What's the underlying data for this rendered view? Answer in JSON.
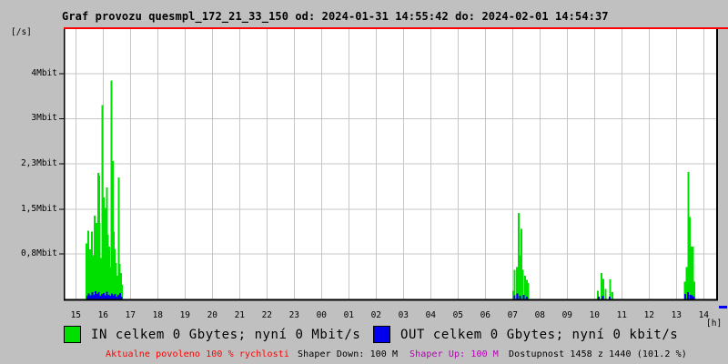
{
  "title": "Graf provozu quesmpl_172_21_33_150 od: 2024-01-31 14:55:42 do: 2024-02-01 14:54:37",
  "colors": {
    "background": "#c0c0c0",
    "plot_background": "#ffffff",
    "grid": "#c6c6c6",
    "border": "#000000",
    "limit_line": "#ff0000",
    "in_series": "#00e000",
    "out_series": "#0000ee",
    "warning_text": "#ff0000",
    "shaper_up_text": "#b400b4",
    "plain_text": "#000000"
  },
  "chart_data": {
    "type": "area",
    "title": "Graf provozu quesmpl_172_21_33_150 od: 2024-01-31 14:55:42 do: 2024-02-01 14:54:37",
    "y_unit_label": "[/s]",
    "x_unit_label": "[h]",
    "x_tick_labels": [
      "15",
      "16",
      "17",
      "18",
      "19",
      "20",
      "21",
      "22",
      "23",
      "00",
      "01",
      "02",
      "03",
      "04",
      "05",
      "06",
      "07",
      "08",
      "09",
      "10",
      "11",
      "12",
      "13",
      "14"
    ],
    "y_ticks": [
      {
        "label": "4Mbit",
        "mbit": 3.83
      },
      {
        "label": "3Mbit",
        "mbit": 3.07
      },
      {
        "label": "2,3Mbit",
        "mbit": 2.3
      },
      {
        "label": "1,5Mbit",
        "mbit": 1.53
      },
      {
        "label": "0,8Mbit",
        "mbit": 0.77
      }
    ],
    "ylim_mbit": [
      0,
      4.6
    ],
    "x_axis_note": "points are [hours since 15:00, Mbit/s]",
    "grid": true,
    "series": [
      {
        "name": "IN",
        "color": "#00e000",
        "points": [
          [
            0.39,
            0.95
          ],
          [
            0.46,
            1.17
          ],
          [
            0.52,
            0.85
          ],
          [
            0.59,
            1.15
          ],
          [
            0.62,
            0.75
          ],
          [
            0.66,
            0.6
          ],
          [
            0.69,
            1.42
          ],
          [
            0.73,
            0.95
          ],
          [
            0.76,
            1.3
          ],
          [
            0.82,
            2.15
          ],
          [
            0.86,
            2.1
          ],
          [
            0.88,
            1.3
          ],
          [
            0.92,
            0.7
          ],
          [
            0.97,
            3.3
          ],
          [
            1.0,
            1.2
          ],
          [
            1.02,
            1.73
          ],
          [
            1.05,
            0.8
          ],
          [
            1.09,
            1.55
          ],
          [
            1.14,
            1.9
          ],
          [
            1.17,
            1.1
          ],
          [
            1.22,
            0.9
          ],
          [
            1.27,
            0.55
          ],
          [
            1.31,
            3.72
          ],
          [
            1.36,
            2.35
          ],
          [
            1.39,
            1.15
          ],
          [
            1.42,
            0.86
          ],
          [
            1.47,
            0.62
          ],
          [
            1.52,
            0.4
          ],
          [
            1.57,
            2.07
          ],
          [
            1.6,
            0.6
          ],
          [
            1.62,
            0.35
          ],
          [
            1.65,
            0.45
          ],
          [
            1.69,
            0.25
          ],
          [
            16.02,
            0.15
          ],
          [
            16.08,
            0.5
          ],
          [
            16.15,
            0.55
          ],
          [
            16.22,
            1.47
          ],
          [
            16.27,
            0.75
          ],
          [
            16.32,
            1.2
          ],
          [
            16.38,
            0.5
          ],
          [
            16.45,
            0.4
          ],
          [
            16.52,
            0.33
          ],
          [
            16.58,
            0.28
          ],
          [
            19.12,
            0.15
          ],
          [
            19.25,
            0.45
          ],
          [
            19.33,
            0.35
          ],
          [
            19.4,
            0.18
          ],
          [
            19.58,
            0.34
          ],
          [
            19.65,
            0.12
          ],
          [
            22.3,
            0.3
          ],
          [
            22.37,
            0.55
          ],
          [
            22.44,
            2.16
          ],
          [
            22.49,
            1.4
          ],
          [
            22.54,
            0.9
          ],
          [
            22.6,
            0.9
          ],
          [
            22.66,
            0.3
          ]
        ]
      },
      {
        "name": "OUT",
        "color": "#0000ee",
        "points": [
          [
            0.42,
            0.06
          ],
          [
            0.48,
            0.1
          ],
          [
            0.54,
            0.07
          ],
          [
            0.6,
            0.12
          ],
          [
            0.66,
            0.08
          ],
          [
            0.72,
            0.14
          ],
          [
            0.78,
            0.09
          ],
          [
            0.84,
            0.12
          ],
          [
            0.9,
            0.06
          ],
          [
            0.96,
            0.09
          ],
          [
            1.02,
            0.11
          ],
          [
            1.08,
            0.07
          ],
          [
            1.14,
            0.13
          ],
          [
            1.2,
            0.08
          ],
          [
            1.26,
            0.06
          ],
          [
            1.32,
            0.1
          ],
          [
            1.38,
            0.07
          ],
          [
            1.44,
            0.09
          ],
          [
            1.5,
            0.05
          ],
          [
            1.56,
            0.08
          ],
          [
            1.62,
            0.11
          ],
          [
            1.68,
            0.05
          ],
          [
            16.08,
            0.07
          ],
          [
            16.18,
            0.1
          ],
          [
            16.28,
            0.06
          ],
          [
            16.4,
            0.08
          ],
          [
            16.52,
            0.05
          ],
          [
            19.15,
            0.05
          ],
          [
            19.3,
            0.06
          ],
          [
            19.55,
            0.05
          ],
          [
            22.33,
            0.09
          ],
          [
            22.42,
            0.12
          ],
          [
            22.5,
            0.08
          ],
          [
            22.58,
            0.07
          ],
          [
            22.64,
            0.05
          ]
        ]
      }
    ]
  },
  "legend": [
    {
      "name": "IN",
      "swatch_color": "#00e000",
      "label": "IN celkem 0 Gbytes; nyní 0 Mbit/s"
    },
    {
      "name": "OUT",
      "swatch_color": "#0000ee",
      "label": "OUT celkem 0 Gbytes; nyní 0 kbit/s"
    }
  ],
  "status_bar": {
    "allowed": {
      "text": "Aktualne povoleno 100 % rychlosti",
      "color": "#ff0000"
    },
    "shaper_down": {
      "text": "Shaper Down: 100 M",
      "color": "#000000"
    },
    "shaper_up": {
      "text": "Shaper Up: 100 M",
      "color": "#b400b4"
    },
    "availability": {
      "text": "Dostupnost 1458 z 1440 (101.2 %)",
      "color": "#000000"
    }
  }
}
